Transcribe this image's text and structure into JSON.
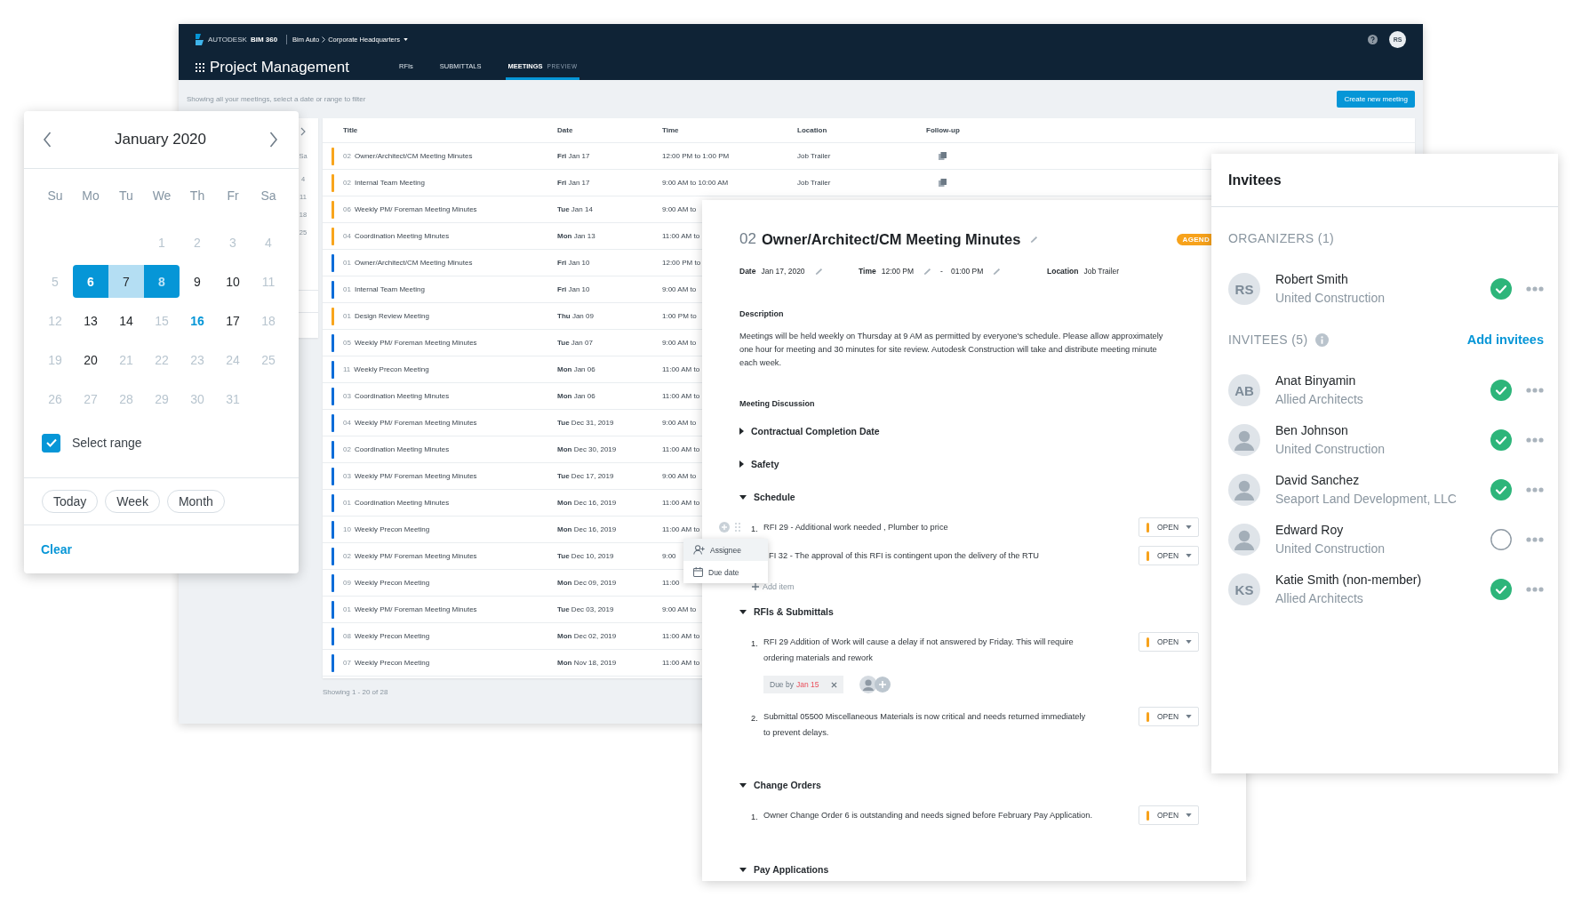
{
  "app": {
    "brand": "AUTODESK",
    "product": "BIM 360",
    "project": "Bim Auto",
    "location": "Corporate Headquarters",
    "title": "Project Management",
    "tabs": [
      {
        "label": "RFIs",
        "selected": false
      },
      {
        "label": "SUBMITTALS",
        "selected": false
      },
      {
        "label": "MEETINGS",
        "tag": "PREVIEW",
        "selected": true
      }
    ],
    "user_initials": "RS",
    "filter_hint": "Showing all your meetings, select a date or range to filter",
    "create_button": "Create new meeting"
  },
  "sidebar_calendar": {
    "weekday": "Sa",
    "days": [
      "4",
      "11",
      "18",
      "25"
    ]
  },
  "table": {
    "columns": [
      "Title",
      "Date",
      "Time",
      "Location",
      "Follow-up"
    ],
    "rows": [
      {
        "color": "#f8a51c",
        "number": "02",
        "title": "Owner/Architect/CM Meeting Minutes",
        "date": "**Fri** Jan 17",
        "time": "12:00 PM to 1:00 PM",
        "location": "Job Trailer",
        "follow_up": true
      },
      {
        "color": "#f8a51c",
        "number": "02",
        "title": "Internal Team Meeting",
        "date": "**Fri** Jan 17",
        "time": "9:00 AM to 10:00 AM",
        "location": "Job Trailer",
        "follow_up": true
      },
      {
        "color": "#f8a51c",
        "number": "06",
        "title": "Weekly PM/ Foreman Meeting Minutes",
        "date": "**Tue** Jan 14",
        "time": "9:00 AM to"
      },
      {
        "color": "#f8a51c",
        "number": "04",
        "title": "Coordination Meeting Minutes",
        "date": "**Mon** Jan 13",
        "time": "11:00 AM to"
      },
      {
        "color": "#0b6cd8",
        "number": "01",
        "title": "Owner/Architect/CM Meeting Minutes",
        "date": "**Fri** Jan 10",
        "time": "12:00 PM to"
      },
      {
        "color": "#0b6cd8",
        "number": "01",
        "title": "Internal Team Meeting",
        "date": "**Fri** Jan 10",
        "time": "9:00 AM to"
      },
      {
        "color": "#f8a51c",
        "number": "01",
        "title": "Design Review Meeting",
        "date": "**Thu** Jan 09",
        "time": "1:00 PM to"
      },
      {
        "color": "#0b6cd8",
        "number": "05",
        "title": "Weekly PM/ Foreman Meeting Minutes",
        "date": "**Tue** Jan 07",
        "time": "9:00 AM to"
      },
      {
        "color": "#0b6cd8",
        "number": "11",
        "title": "Weekly Precon Meeting",
        "date": "**Mon** Jan 06",
        "time": "11:00 AM to"
      },
      {
        "color": "#0b6cd8",
        "number": "03",
        "title": "Coordination Meeting Minutes",
        "date": "**Mon** Jan 06",
        "time": "11:00 AM to"
      },
      {
        "color": "#0b6cd8",
        "number": "04",
        "title": "Weekly PM/ Foreman Meeting Minutes",
        "date": "**Tue** Dec 31, 2019",
        "time": "9:00 AM to"
      },
      {
        "color": "#0b6cd8",
        "number": "02",
        "title": "Coordination Meeting Minutes",
        "date": "**Mon** Dec 30, 2019",
        "time": "11:00 AM to"
      },
      {
        "color": "#0b6cd8",
        "number": "03",
        "title": "Weekly PM/ Foreman Meeting Minutes",
        "date": "**Tue** Dec 17, 2019",
        "time": "9:00 AM to"
      },
      {
        "color": "#0b6cd8",
        "number": "01",
        "title": "Coordination Meeting Minutes",
        "date": "**Mon** Dec 16, 2019",
        "time": "11:00 AM to"
      },
      {
        "color": "#0b6cd8",
        "number": "10",
        "title": "Weekly Precon Meeting",
        "date": "**Mon** Dec 16, 2019",
        "time": "11:00 AM to"
      },
      {
        "color": "#0b6cd8",
        "number": "02",
        "title": "Weekly PM/ Foreman Meeting Minutes",
        "date": "**Tue** Dec 10, 2019",
        "time": "9:00"
      },
      {
        "color": "#0b6cd8",
        "number": "09",
        "title": "Weekly Precon Meeting",
        "date": "**Mon** Dec 09, 2019",
        "time": "11:00"
      },
      {
        "color": "#0b6cd8",
        "number": "01",
        "title": "Weekly PM/ Foreman Meeting Minutes",
        "date": "**Tue** Dec 03, 2019",
        "time": "9:00 AM to"
      },
      {
        "color": "#0b6cd8",
        "number": "08",
        "title": "Weekly Precon Meeting",
        "date": "**Mon** Dec 02, 2019",
        "time": "11:00 AM to"
      },
      {
        "color": "#0b6cd8",
        "number": "07",
        "title": "Weekly Precon Meeting",
        "date": "**Mon** Nov 18, 2019",
        "time": "11:00 AM to"
      }
    ],
    "footer": "Showing 1 - 20 of 28"
  },
  "calendar": {
    "month": "January 2020",
    "weekdays": [
      "Su",
      "Mo",
      "Tu",
      "We",
      "Th",
      "Fr",
      "Sa"
    ],
    "weeks": [
      [
        {
          "label": "1",
          "muted": true,
          "today": false,
          "in_range": false,
          "selected": false
        },
        {
          "label": "2",
          "muted": true,
          "today": false,
          "in_range": false,
          "selected": false
        },
        {
          "label": "3",
          "muted": true,
          "today": false,
          "in_range": false,
          "selected": false
        },
        {
          "label": "4",
          "muted": true,
          "today": false,
          "in_range": false,
          "selected": false
        }
      ],
      [
        {
          "label": "5",
          "muted": true,
          "today": false,
          "in_range": false,
          "selected": false
        },
        {
          "label": "6",
          "muted": false,
          "today": false,
          "in_range": true,
          "selected": true
        },
        {
          "label": "7",
          "muted": false,
          "today": false,
          "in_range": true,
          "selected": false
        },
        {
          "label": "8",
          "muted": true,
          "today": false,
          "in_range": true,
          "selected": true
        },
        {
          "label": "9",
          "muted": false,
          "today": false,
          "in_range": false,
          "selected": false
        },
        {
          "label": "10",
          "muted": false,
          "today": false,
          "in_range": false,
          "selected": false
        },
        {
          "label": "11",
          "muted": true,
          "today": false,
          "in_range": false,
          "selected": false
        }
      ],
      [
        {
          "label": "12",
          "muted": true,
          "today": false,
          "in_range": false,
          "selected": false
        },
        {
          "label": "13",
          "muted": false,
          "today": false,
          "in_range": false,
          "selected": false
        },
        {
          "label": "14",
          "muted": false,
          "today": false,
          "in_range": false,
          "selected": false
        },
        {
          "label": "15",
          "muted": true,
          "today": false,
          "in_range": false,
          "selected": false
        },
        {
          "label": "16",
          "muted": false,
          "today": true,
          "in_range": false,
          "selected": false
        },
        {
          "label": "17",
          "muted": false,
          "today": false,
          "in_range": false,
          "selected": false
        },
        {
          "label": "18",
          "muted": true,
          "today": false,
          "in_range": false,
          "selected": false
        }
      ],
      [
        {
          "label": "19",
          "muted": true,
          "today": false,
          "in_range": false,
          "selected": false
        },
        {
          "label": "20",
          "muted": false,
          "today": false,
          "in_range": false,
          "selected": false
        },
        {
          "label": "21",
          "muted": true,
          "today": false,
          "in_range": false,
          "selected": false
        },
        {
          "label": "22",
          "muted": true,
          "today": false,
          "in_range": false,
          "selected": false
        },
        {
          "label": "23",
          "muted": true,
          "today": false,
          "in_range": false,
          "selected": false
        },
        {
          "label": "24",
          "muted": true,
          "today": false,
          "in_range": false,
          "selected": false
        },
        {
          "label": "25",
          "muted": true,
          "today": false,
          "in_range": false,
          "selected": false
        }
      ],
      [
        {
          "label": "26",
          "muted": true,
          "today": false,
          "in_range": false,
          "selected": false
        },
        {
          "label": "27",
          "muted": true,
          "today": false,
          "in_range": false,
          "selected": false
        },
        {
          "label": "28",
          "muted": true,
          "today": false,
          "in_range": false,
          "selected": false
        },
        {
          "label": "29",
          "muted": true,
          "today": false,
          "in_range": false,
          "selected": false
        },
        {
          "label": "30",
          "muted": true,
          "today": false,
          "in_range": false,
          "selected": false
        },
        {
          "label": "31",
          "muted": true,
          "today": false,
          "in_range": false,
          "selected": false
        }
      ]
    ],
    "select_range": {
      "label": "Select range",
      "checked": true
    },
    "shortcuts": [
      "Today",
      "Week",
      "Month"
    ],
    "clear": "Clear"
  },
  "meeting": {
    "number": "02",
    "title": "Owner/Architect/CM Meeting Minutes",
    "badge": "AGEND",
    "date_label": "Date",
    "date": "Jan 17, 2020",
    "time_label": "Time",
    "start_time": "12:00 PM",
    "separator": "-",
    "end_time": "01:00 PM",
    "location_label": "Location",
    "location": "Job Trailer",
    "description_heading": "Description",
    "description": [
      "Meetings will be held weekly on Thursday at 9 AM as permitted by everyone's schedule. Please allow approximately",
      "one hour for meeting and 30 minutes for site review. Autodesk Construction will take and distribute meeting minute",
      "each week."
    ],
    "discussion_heading": "Meeting Discussion",
    "sections": [
      {
        "title": "Contractual Completion Date",
        "expanded": false
      },
      {
        "title": "Safety",
        "expanded": false
      },
      {
        "title": "Schedule",
        "expanded": true,
        "items": [
          {
            "number": "1.",
            "lines": [
              "RFI 29 - Additional work needed , Plumber to price"
            ],
            "status": "OPEN",
            "show_handles": true
          },
          {
            "lines": [
              "FI 32 - The approval of this RFI is contingent upon the delivery of the RTU"
            ],
            "status": "OPEN",
            "show_handles": false
          }
        ],
        "add_item": "Add item"
      },
      {
        "title": "RFIs & Submittals",
        "expanded": true,
        "items": [
          {
            "number": "1.",
            "lines": [
              "RFI 29 Addition of Work will cause a delay if not answered by Friday. This will require",
              "ordering materials and rework"
            ],
            "status": "OPEN",
            "show_handles": false,
            "due_label": "Due by",
            "due_date": "Jan 15",
            "assignees": [
              {
                "kind": "photo"
              },
              {
                "kind": "add"
              }
            ]
          },
          {
            "number": "2.",
            "lines": [
              "Submittal 05500 Miscellaneous Materials is now critical and needs returned immediately",
              "to prevent delays."
            ],
            "status": "OPEN",
            "show_handles": false
          }
        ]
      },
      {
        "title": "Change Orders",
        "expanded": true,
        "items": [
          {
            "number": "1.",
            "lines": [
              "Owner Change Order 6 is outstanding and needs signed before February Pay Application."
            ],
            "status": "OPEN",
            "show_handles": false
          }
        ]
      },
      {
        "title": "Pay Applications",
        "expanded": true
      }
    ]
  },
  "context_menu": [
    {
      "label": "Assignee",
      "selected": true
    },
    {
      "label": "Due date",
      "selected": false
    }
  ],
  "invitees_panel": {
    "title": "Invitees",
    "organizers_heading": "ORGANIZERS (1)",
    "organizers": [
      {
        "kind": "initials",
        "initials": "RS",
        "name": "Robert Smith",
        "company": "United Construction",
        "accepted": true
      }
    ],
    "invitees_heading": "INVITEES (5)",
    "add_link": "Add invitees",
    "invitees": [
      {
        "kind": "initials",
        "initials": "AB",
        "name": "Anat Binyamin",
        "company": "Allied Architects",
        "accepted": true
      },
      {
        "kind": "photo",
        "name": "Ben Johnson",
        "company": "United Construction",
        "accepted": true
      },
      {
        "kind": "photo",
        "name": "David Sanchez",
        "company": "Seaport Land Development, LLC",
        "accepted": true
      },
      {
        "kind": "photo",
        "name": "Edward Roy",
        "company": "United Construction",
        "accepted": false
      },
      {
        "kind": "initials",
        "initials": "KS",
        "name": "Katie Smith (non-member)",
        "company": "Allied Architects",
        "accepted": true
      }
    ]
  }
}
